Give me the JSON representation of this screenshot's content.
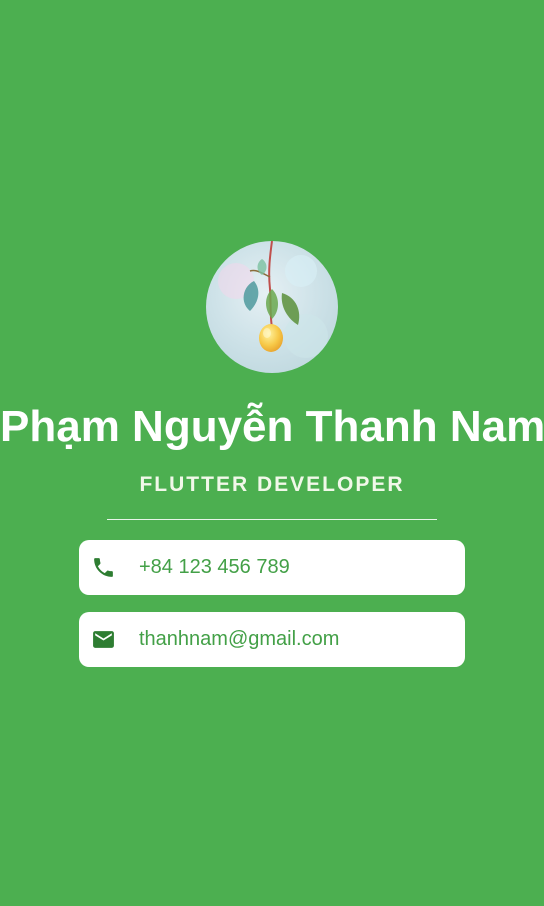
{
  "profile": {
    "avatar_alt": "profile photo",
    "name": "Phạm Nguyễn Thanh Nam",
    "title": "FLUTTER DEVELOPER"
  },
  "contacts": [
    {
      "type": "phone",
      "icon": "phone-icon",
      "value": "+84 123 456 789"
    },
    {
      "type": "email",
      "icon": "email-icon",
      "value": "thanhnam@gmail.com"
    }
  ],
  "colors": {
    "background": "#4caf50",
    "card": "#ffffff",
    "accent_text": "#43a047",
    "icon": "#2e7d32"
  }
}
